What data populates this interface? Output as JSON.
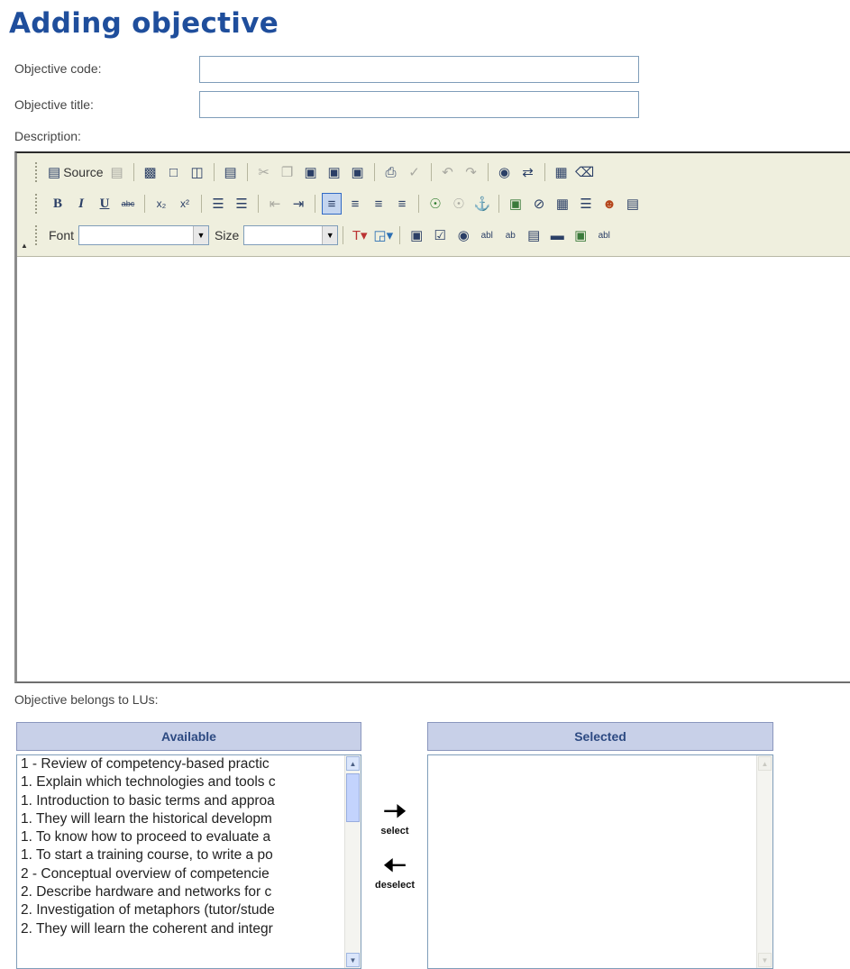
{
  "page": {
    "title": "Adding objective"
  },
  "form": {
    "code_label": "Objective code:",
    "code_value": "",
    "title_label": "Objective title:",
    "title_value": "",
    "description_label": "Description:"
  },
  "editor": {
    "source_label": "Source",
    "font_label": "Font",
    "font_value": "",
    "size_label": "Size",
    "size_value": ""
  },
  "lus": {
    "label": "Objective belongs to LUs:",
    "available_header": "Available",
    "selected_header": "Selected",
    "select_label": "select",
    "deselect_label": "deselect",
    "available_items": [
      "1 - Review of competency-based practic",
      "1. Explain which technologies and tools c",
      "1. Introduction to basic terms and approa",
      "1. They will learn the historical developm",
      "1. To know how to proceed to evaluate a",
      "1. To start a training course, to write a po",
      "2 - Conceptual overview of competencie",
      "2. Describe hardware and networks for c",
      "2. Investigation of metaphors (tutor/stude",
      "2. They will learn the coherent and integr"
    ],
    "selected_items": []
  }
}
